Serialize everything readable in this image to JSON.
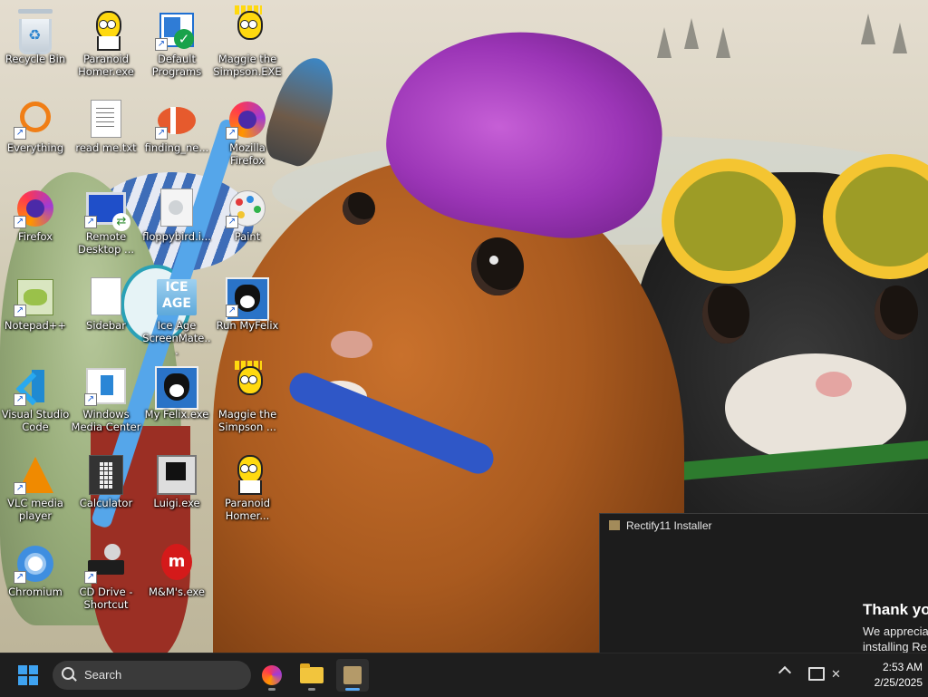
{
  "desktop": {
    "icons": [
      {
        "label": "Recycle Bin"
      },
      {
        "label": "Paranoid Homer.exe"
      },
      {
        "label": "Default Programs"
      },
      {
        "label": "Maggie the Simpson.EXE"
      },
      {
        "label": "Everything"
      },
      {
        "label": "read me.txt"
      },
      {
        "label": "finding_ne..."
      },
      {
        "label": "Mozilla Firefox"
      },
      {
        "label": "Firefox"
      },
      {
        "label": "Remote Desktop ..."
      },
      {
        "label": "floppybird.i..."
      },
      {
        "label": "Paint"
      },
      {
        "label": "Notepad++"
      },
      {
        "label": "Sidebar"
      },
      {
        "label": "Ice Age ScreenMate..."
      },
      {
        "label": "Run MyFelix"
      },
      {
        "label": "Visual Studio Code"
      },
      {
        "label": "Windows Media Center"
      },
      {
        "label": "My Felix.exe"
      },
      {
        "label": "Maggie the Simpson ..."
      },
      {
        "label": "VLC media player"
      },
      {
        "label": "Calculator"
      },
      {
        "label": "Luigi.exe"
      },
      {
        "label": "Paranoid Homer..."
      },
      {
        "label": "Chromium"
      },
      {
        "label": "CD Drive - Shortcut"
      },
      {
        "label": "M&M's.exe"
      }
    ],
    "ice_age_text": "ICE AGE",
    "mm_text": "m"
  },
  "installer": {
    "title": "Rectify11 Installer",
    "heading": "Thank yo",
    "message_line1": "We apprecia",
    "message_line2": "installing Re"
  },
  "taskbar": {
    "search_placeholder": "Search",
    "clock_time": "2:53 AM",
    "clock_date": "2/25/2025"
  },
  "colors": {
    "taskbar_bg": "#1e1e1e",
    "accent": "#58a8f4",
    "installer_bg": "#1c1c1c"
  }
}
